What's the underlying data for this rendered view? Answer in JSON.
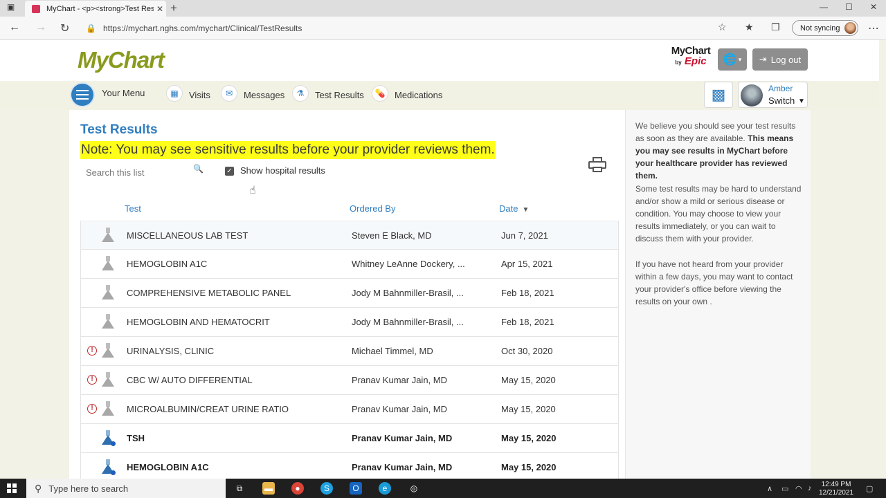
{
  "browser": {
    "tab_title": "MyChart - <p><strong>Test Res",
    "tab_close": "✕",
    "new_tab": "+",
    "url": "https://mychart.nghs.com/mychart/Clinical/TestResults",
    "sync_label": "Not syncing"
  },
  "header": {
    "logo": "MyChart",
    "epic_line1": "MyChart",
    "epic_by": "by",
    "epic_line2": "Epic",
    "logout_label": "Log out"
  },
  "menu": {
    "your_menu": "Your Menu",
    "items": [
      {
        "label": "Visits",
        "icon": "calendar-icon"
      },
      {
        "label": "Messages",
        "icon": "envelope-icon"
      },
      {
        "label": "Test Results",
        "icon": "flask-icon"
      },
      {
        "label": "Medications",
        "icon": "pill-icon"
      }
    ],
    "user_name": "Amber",
    "switch_label": "Switch"
  },
  "main": {
    "title": "Test Results",
    "note": "Note: You may see sensitive results before your provider reviews them.",
    "search_placeholder": "Search this list",
    "show_hospital_label": "Show hospital results",
    "show_hospital_checked": true,
    "columns": {
      "test": "Test",
      "ordered_by": "Ordered By",
      "date": "Date"
    },
    "rows": [
      {
        "test": "MISCELLANEOUS LAB TEST",
        "ordered_by": "Steven E Black, MD",
        "date": "Jun 7, 2021",
        "alert": false,
        "new": false
      },
      {
        "test": "HEMOGLOBIN A1C",
        "ordered_by": "Whitney LeAnne Dockery, ...",
        "date": "Apr 15, 2021",
        "alert": false,
        "new": false
      },
      {
        "test": "COMPREHENSIVE METABOLIC PANEL",
        "ordered_by": "Jody M Bahnmiller-Brasil, ...",
        "date": "Feb 18, 2021",
        "alert": false,
        "new": false
      },
      {
        "test": "HEMOGLOBIN AND HEMATOCRIT",
        "ordered_by": "Jody M Bahnmiller-Brasil, ...",
        "date": "Feb 18, 2021",
        "alert": false,
        "new": false
      },
      {
        "test": "URINALYSIS, CLINIC",
        "ordered_by": "Michael Timmel, MD",
        "date": "Oct 30, 2020",
        "alert": true,
        "new": false
      },
      {
        "test": "CBC W/ AUTO DIFFERENTIAL",
        "ordered_by": "Pranav Kumar Jain, MD",
        "date": "May 15, 2020",
        "alert": true,
        "new": false
      },
      {
        "test": "MICROALBUMIN/CREAT URINE RATIO",
        "ordered_by": "Pranav Kumar Jain, MD",
        "date": "May 15, 2020",
        "alert": true,
        "new": false
      },
      {
        "test": "TSH",
        "ordered_by": "Pranav Kumar Jain, MD",
        "date": "May 15, 2020",
        "alert": false,
        "new": true
      },
      {
        "test": "HEMOGLOBIN A1C",
        "ordered_by": "Pranav Kumar Jain, MD",
        "date": "May 15, 2020",
        "alert": false,
        "new": true
      }
    ]
  },
  "sidebar": {
    "p1_a": "We believe you should see your test results as soon as they are available. ",
    "p1_b": "This means you may see results in MyChart before your healthcare provider has reviewed them.",
    "p2": "Some test results may be hard to understand and/or show a mild or serious disease or condition. You may choose to view your results immediately, or you can wait to discuss them with your provider.",
    "p3": "If you have not heard from your provider within a few days, you may want to contact your provider's office before viewing the results on your own ."
  },
  "taskbar": {
    "search_placeholder": "Type here to search",
    "time": "12:49 PM",
    "date": "12/21/2021"
  },
  "colors": {
    "accent": "#2f7ec0",
    "note_highlight": "#ffff19",
    "alert": "#c0282d",
    "logo": "#8a9a1e"
  }
}
